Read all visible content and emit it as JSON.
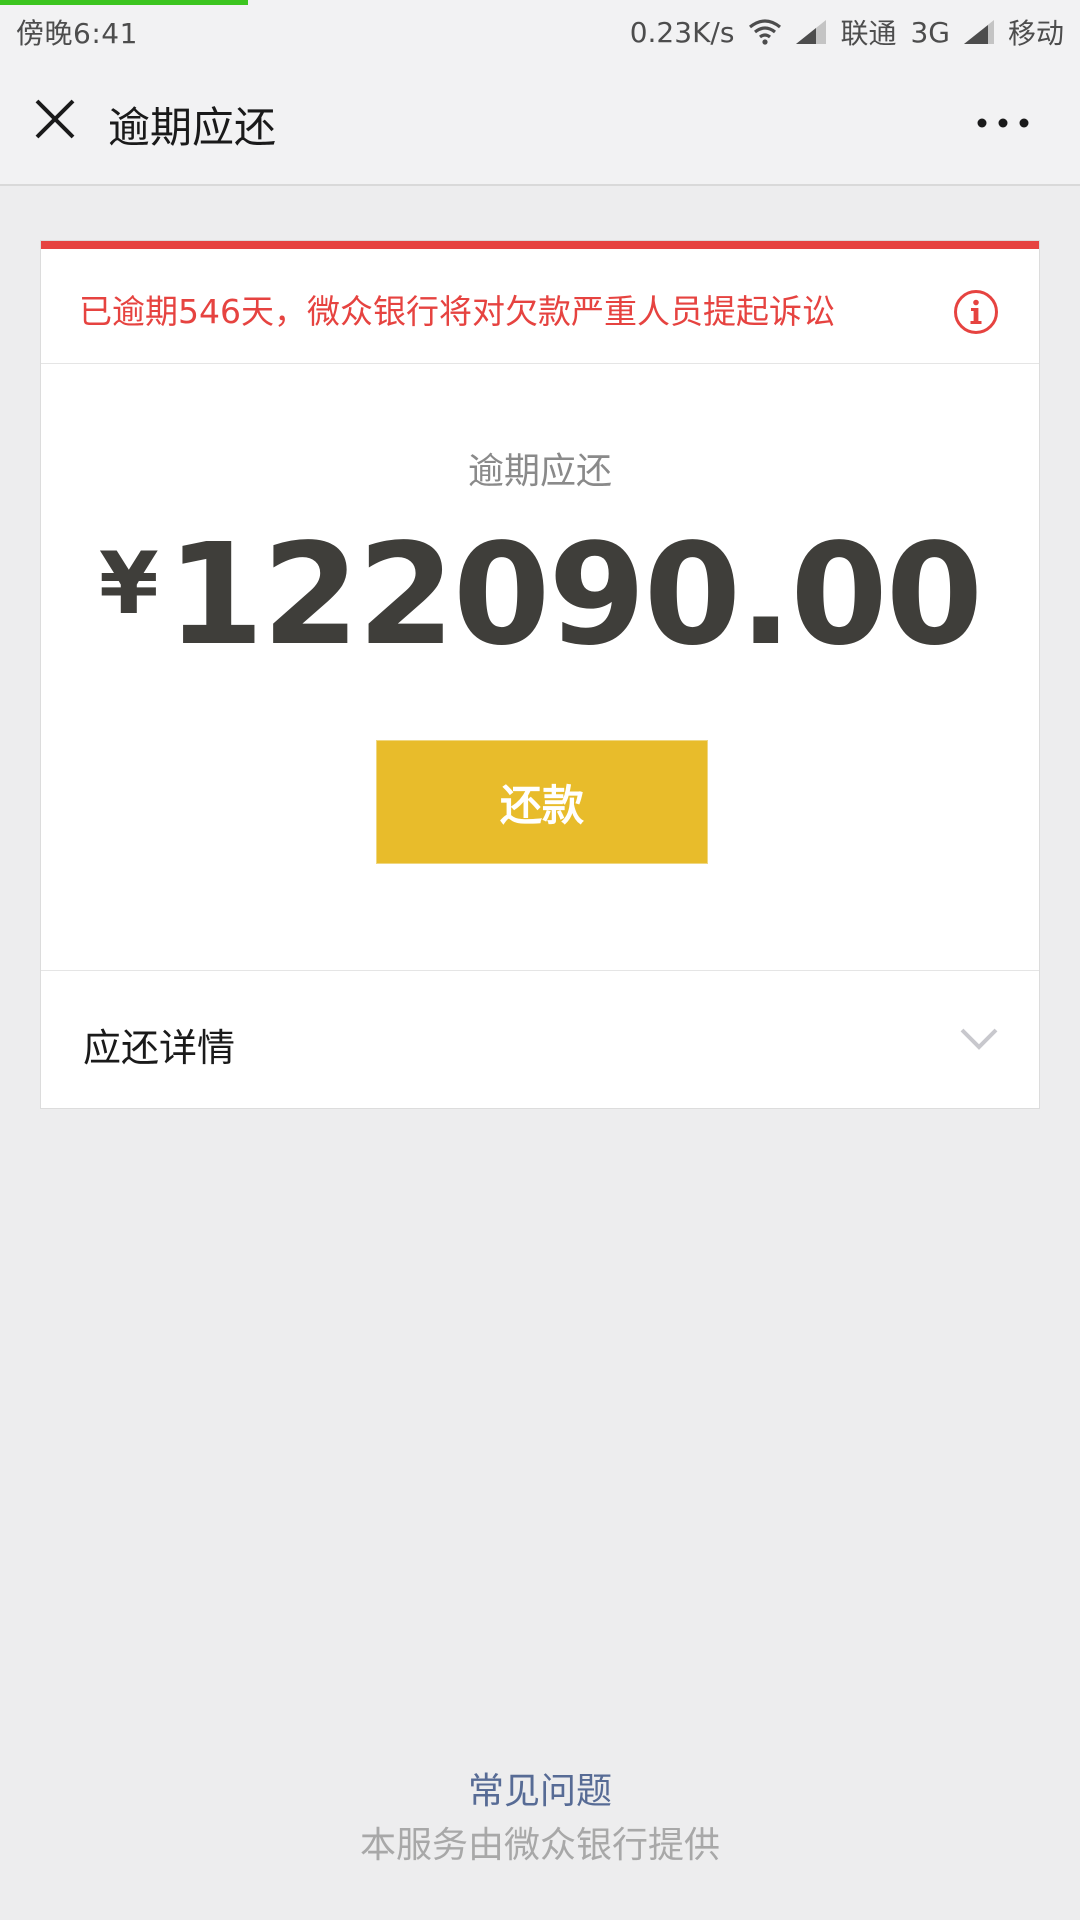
{
  "status_bar": {
    "time": "傍晚6:41",
    "net_speed": "0.23K/s",
    "carrier_1": "联通",
    "network_type": "3G",
    "carrier_2": "移动",
    "page_load_progress_percent": 23
  },
  "nav": {
    "title": "逾期应还"
  },
  "alert": {
    "text": "已逾期546天，微众银行将对欠款严重人员提起诉讼",
    "color": "#e64340"
  },
  "amount": {
    "label": "逾期应还",
    "currency": "¥",
    "value": "122090.00"
  },
  "repay_button": {
    "label": "还款",
    "color": "#e8bc2b"
  },
  "details": {
    "label": "应还详情"
  },
  "footer": {
    "faq": "常见问题",
    "provider": "本服务由微众银行提供"
  }
}
